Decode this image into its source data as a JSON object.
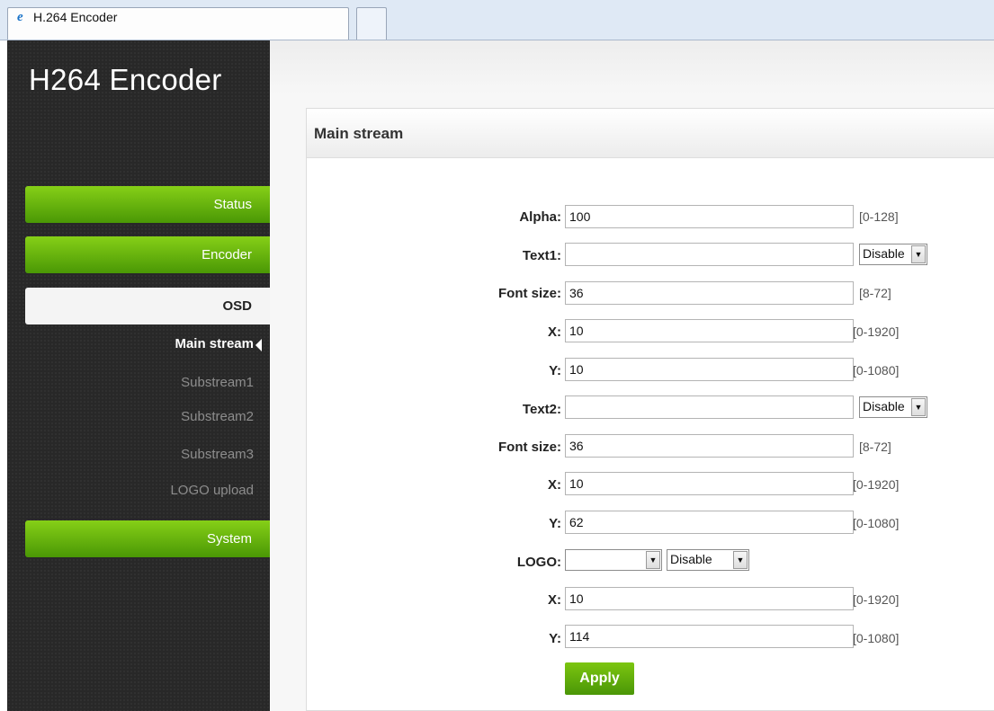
{
  "browser": {
    "tab_title": "H.264 Encoder",
    "tab_icon": "ie-icon"
  },
  "sidebar": {
    "logo": "H264 Encoder",
    "nav": {
      "status": "Status",
      "encoder": "Encoder",
      "osd": "OSD",
      "system": "System"
    },
    "sub": {
      "main_stream": "Main stream",
      "substream1": "Substream1",
      "substream2": "Substream2",
      "substream3": "Substream3",
      "logo_upload": "LOGO upload"
    }
  },
  "panel": {
    "title": "Main stream"
  },
  "form": {
    "alpha": {
      "label": "Alpha:",
      "value": "100",
      "range": "[0-128]"
    },
    "text1": {
      "label": "Text1:",
      "value": "",
      "select": "Disable"
    },
    "font_size1": {
      "label": "Font size:",
      "value": "36",
      "range": "[8-72]"
    },
    "x1": {
      "label": "X:",
      "value": "10",
      "range": "[0-1920]"
    },
    "y1": {
      "label": "Y:",
      "value": "10",
      "range": "[0-1080]"
    },
    "text2": {
      "label": "Text2:",
      "value": "",
      "select": "Disable"
    },
    "font_size2": {
      "label": "Font size:",
      "value": "36",
      "range": "[8-72]"
    },
    "x2": {
      "label": "X:",
      "value": "10",
      "range": "[0-1920]"
    },
    "y2": {
      "label": "Y:",
      "value": "62",
      "range": "[0-1080]"
    },
    "logo": {
      "label": "LOGO:",
      "select_file": "",
      "select": "Disable"
    },
    "x3": {
      "label": "X:",
      "value": "10",
      "range": "[0-1920]"
    },
    "y3": {
      "label": "Y:",
      "value": "114",
      "range": "[0-1080]"
    },
    "apply_label": "Apply"
  },
  "colors": {
    "accent_green": "#5fad0b",
    "sidebar_bg": "#282828"
  }
}
